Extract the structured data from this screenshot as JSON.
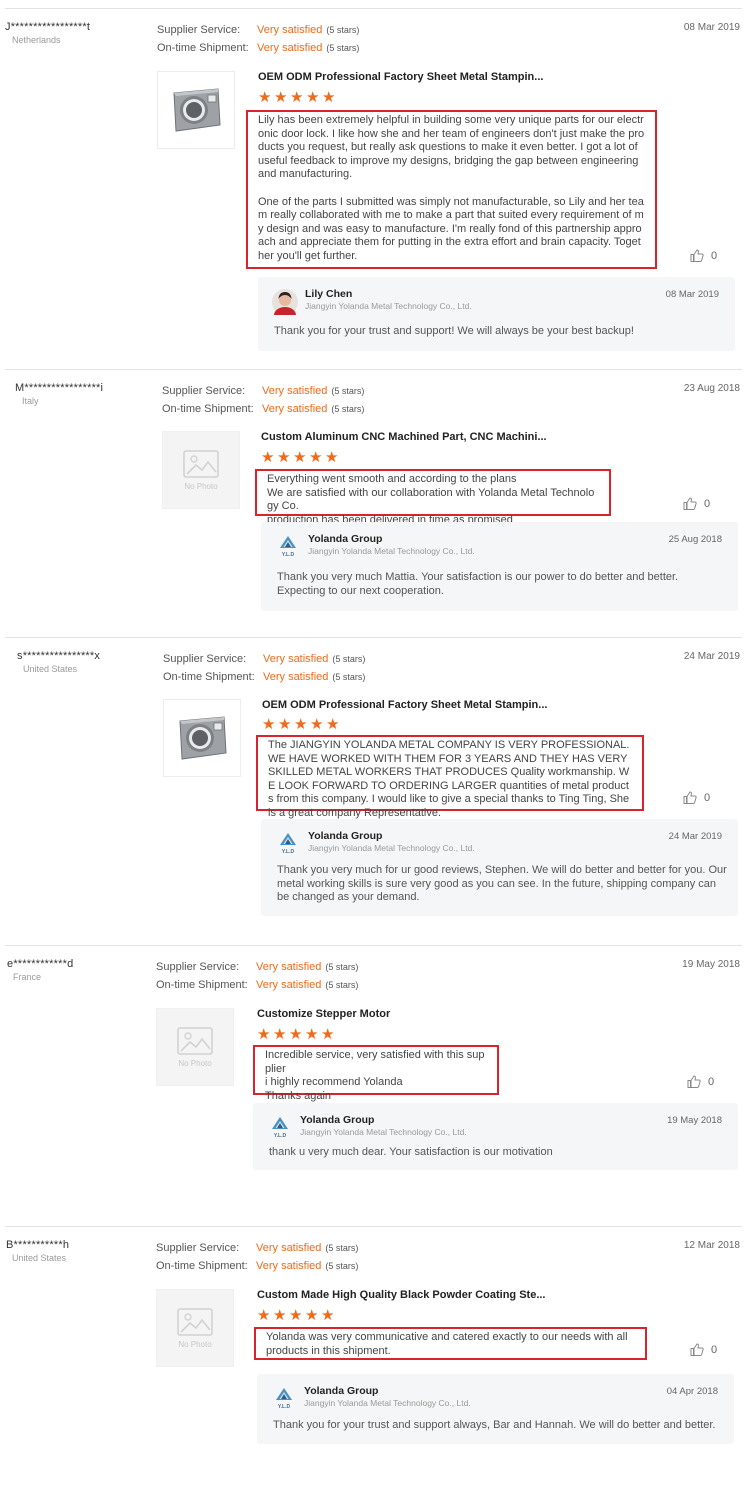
{
  "labels": {
    "supplier_service": "Supplier Service:",
    "on_time_shipment": "On-time Shipment:",
    "no_photo": "No Photo"
  },
  "colors": {
    "accent": "#f06a1a",
    "highlight_border": "#d9232d"
  },
  "reviews": [
    {
      "reviewer": "J*****************t",
      "country": "Netherlands",
      "date": "08 Mar 2019",
      "supplier_service": "Very satisfied",
      "supplier_service_stars": "(5 stars)",
      "on_time_shipment": "Very satisfied",
      "on_time_shipment_stars": "(5 stars)",
      "product_title": "OEM ODM Professional Factory Sheet Metal Stampin...",
      "product_image": "metal-plate-image",
      "rating": 5,
      "comment": [
        "Lily has been extremely helpful in building some very unique parts for our electronic door lock. I like how she and her team of engineers don't just make the products you request, but really ask questions to make it even better. I got a lot of useful feedback to improve my designs, bridging the gap between engineering and manufacturing.",
        "One of the parts I submitted was simply not manufacturable, so Lily and her team really collaborated with me to make a part that suited every requirement of my design and was easy to manufacture. I'm really fond of this partnership approach and appreciate them for putting in the extra effort and brain capacity. Together you'll get further."
      ],
      "likes": "0",
      "reply": {
        "name": "Lily Chen",
        "company": "Jiangyin Yolanda Metal Technology Co., Ltd.",
        "date": "08 Mar 2019",
        "avatar": "person-avatar",
        "text": "Thank you for your trust and support! We will always be your best backup!"
      }
    },
    {
      "reviewer": "M*****************i",
      "country": "Italy",
      "date": "23 Aug 2018",
      "supplier_service": "Very satisfied",
      "supplier_service_stars": "(5 stars)",
      "on_time_shipment": "Very satisfied",
      "on_time_shipment_stars": "(5 stars)",
      "product_title": "Custom Aluminum CNC Machined Part, CNC Machini...",
      "product_image": "no-photo",
      "rating": 5,
      "comment": [
        "Everything went smooth and according to the plans\nWe are satisfied with our collaboration with Yolanda Metal Technology Co.\nproduction has been delivered in time as promised"
      ],
      "likes": "0",
      "reply": {
        "name": "Yolanda Group",
        "company": "Jiangyin Yolanda Metal Technology Co., Ltd.",
        "date": "25 Aug 2018",
        "avatar": "yld-logo",
        "logo_text": "Y.L.D",
        "text": "Thank you very much Mattia. Your satisfaction is our power to do better and better. Expecting to our next cooperation."
      }
    },
    {
      "reviewer": "s****************x",
      "country": "United States",
      "date": "24 Mar 2019",
      "supplier_service": "Very satisfied",
      "supplier_service_stars": "(5 stars)",
      "on_time_shipment": "Very satisfied",
      "on_time_shipment_stars": "(5 stars)",
      "product_title": "OEM ODM Professional Factory Sheet Metal Stampin...",
      "product_image": "metal-plate-image",
      "rating": 5,
      "comment": [
        "The JIANGYIN YOLANDA METAL COMPANY IS VERY PROFESSIONAL.WE HAVE WORKED WITH THEM FOR 3 YEARS AND THEY HAS VERY SKILLED METAL WORKERS THAT PRODUCES Quality workmanship. WE LOOK FORWARD TO ORDERING LARGER quantities of metal products from this company. I would like to give a special thanks to Ting Ting, She is a great company Representative."
      ],
      "likes": "0",
      "reply": {
        "name": "Yolanda Group",
        "company": "Jiangyin Yolanda Metal Technology Co., Ltd.",
        "date": "24 Mar 2019",
        "avatar": "yld-logo",
        "logo_text": "Y.L.D",
        "text": "Thank you very much for ur good reviews, Stephen. We will do better and better for you. Our metal working skills is sure very good as you can see. In the future, shipping company can be changed as your demand."
      }
    },
    {
      "reviewer": "e************d",
      "country": "France",
      "date": "19 May 2018",
      "supplier_service": "Very satisfied",
      "supplier_service_stars": "(5 stars)",
      "on_time_shipment": "Very satisfied",
      "on_time_shipment_stars": "(5 stars)",
      "product_title": "Customize Stepper Motor",
      "product_image": "no-photo",
      "rating": 5,
      "comment": [
        "Incredible service, very satisfied with this supplier\ni highly recommend Yolanda\nThanks again"
      ],
      "likes": "0",
      "reply": {
        "name": "Yolanda Group",
        "company": "Jiangyin Yolanda Metal Technology Co., Ltd.",
        "date": "19 May 2018",
        "avatar": "yld-logo",
        "logo_text": "Y.L.D",
        "text": "thank u very much dear. Your satisfaction is our motivation"
      }
    },
    {
      "reviewer": "B***********h",
      "country": "United States",
      "date": "12 Mar 2018",
      "supplier_service": "Very satisfied",
      "supplier_service_stars": "(5 stars)",
      "on_time_shipment": "Very satisfied",
      "on_time_shipment_stars": "(5 stars)",
      "product_title": "Custom Made High Quality Black Powder Coating Ste...",
      "product_image": "no-photo",
      "rating": 5,
      "comment": [
        "Yolanda was very communicative and catered exactly to our needs with all products in this shipment."
      ],
      "likes": "0",
      "reply": {
        "name": "Yolanda Group",
        "company": "Jiangyin Yolanda Metal Technology Co., Ltd.",
        "date": "04 Apr 2018",
        "avatar": "yld-logo",
        "logo_text": "Y.L.D",
        "text": "Thank you for your trust and support always, Bar and Hannah. We will do better and better."
      }
    }
  ]
}
